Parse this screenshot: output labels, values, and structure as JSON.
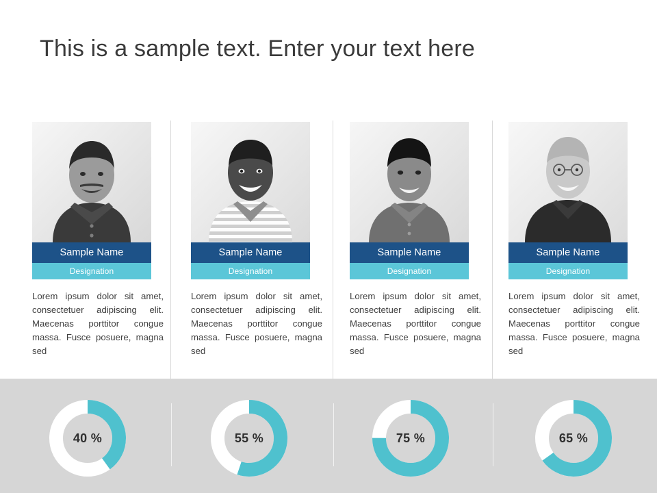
{
  "title": "This is a sample text. Enter your text here",
  "colors": {
    "name_bar": "#1d5288",
    "designation_bar": "#5bc6d8",
    "donut_arc": "#4fc1ce",
    "donut_track": "#ffffff",
    "band_background": "#d6d6d6",
    "title_text": "#3a3a3a"
  },
  "cards": [
    {
      "photo_icon": "person-portrait-photo",
      "name": "Sample Name",
      "designation": "Designation",
      "body": "Lorem ipsum dolor sit amet, consectetuer adipiscing elit. Maecenas porttitor congue massa. Fusce posuere, magna sed"
    },
    {
      "photo_icon": "person-portrait-photo",
      "name": "Sample Name",
      "designation": "Designation",
      "body": "Lorem ipsum dolor sit amet, consectetuer adipiscing elit. Maecenas porttitor congue massa. Fusce posuere, magna sed"
    },
    {
      "photo_icon": "person-portrait-photo",
      "name": "Sample Name",
      "designation": "Designation",
      "body": "Lorem ipsum dolor sit amet, consectetuer adipiscing elit. Maecenas porttitor congue massa. Fusce posuere, magna sed"
    },
    {
      "photo_icon": "person-portrait-photo",
      "name": "Sample Name",
      "designation": "Designation",
      "body": "Lorem ipsum dolor sit amet, consectetuer adipiscing elit. Maecenas porttitor congue massa. Fusce posuere, magna sed"
    }
  ],
  "donuts": [
    {
      "label": "40 %",
      "value": 40
    },
    {
      "label": "55 %",
      "value": 55
    },
    {
      "label": "75 %",
      "value": 75
    },
    {
      "label": "65 %",
      "value": 65
    }
  ],
  "chart_data": {
    "type": "pie",
    "title": "",
    "categories": [
      "Sample Name",
      "Sample Name",
      "Sample Name",
      "Sample Name"
    ],
    "values": [
      40,
      55,
      75,
      65
    ],
    "labels": [
      "40 %",
      "55 %",
      "75 %",
      "65 %"
    ],
    "unit": "%",
    "ylim": [
      0,
      100
    ],
    "grid": false,
    "legend": "none",
    "note": "Four independent progress donut charts, arcs start at 12 o'clock and sweep clockwise"
  }
}
